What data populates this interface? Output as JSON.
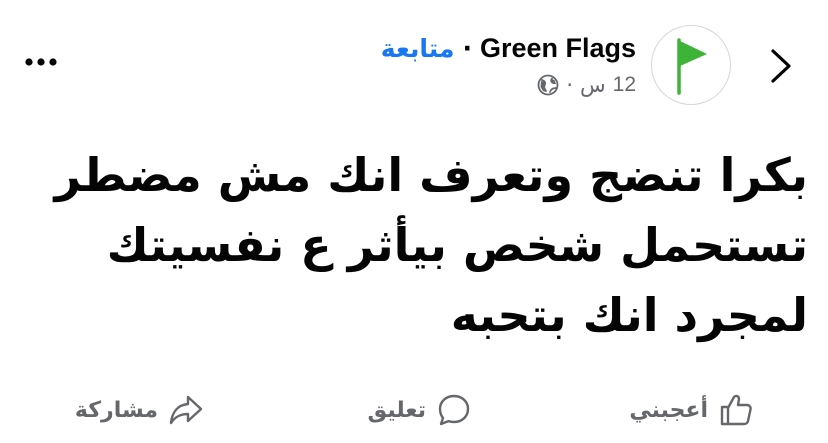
{
  "header": {
    "page_name": "Green Flags",
    "separator": "·",
    "follow_label": "متابعة",
    "time": "12",
    "time_unit": "س",
    "meta_separator": "·",
    "audience_icon": "globe-icon",
    "back_icon": "chevron-right-icon",
    "more_icon": "more-dots-icon",
    "avatar_icon": "green-flag-icon"
  },
  "post": {
    "lines": [
      "بكرا تنضج وتعرف انك مش مضطر",
      "تستحمل  شخص بيأثر ع نفسيتك",
      "لمجرد انك بتحبه"
    ]
  },
  "actions": {
    "like_label": "أعجبني",
    "comment_label": "تعليق",
    "share_label": "مشاركة"
  },
  "colors": {
    "accent": "#1877f2",
    "flag_green": "#3db337",
    "muted_text": "#65676b"
  }
}
